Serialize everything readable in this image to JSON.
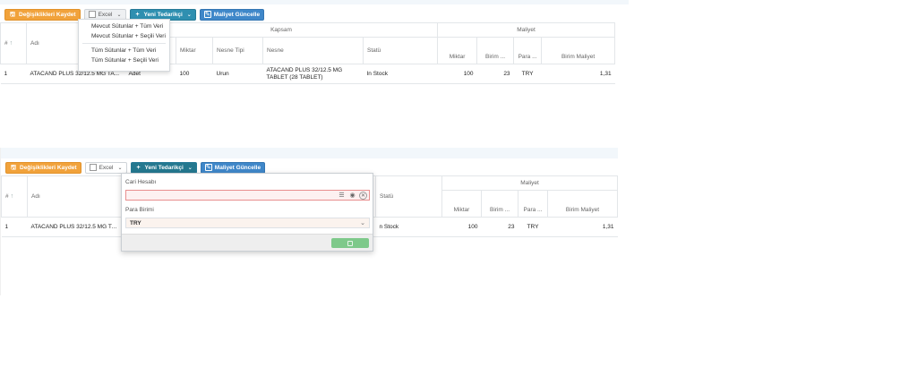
{
  "toolbar": {
    "save": "Değişiklikleri Kaydet",
    "excel": "Excel",
    "new_supplier": "Yeni Tedarikçi",
    "update_cost": "Maliyet Güncelle"
  },
  "excel_menu": [
    "Mevcut Sütunlar + Tüm Veri",
    "Mevcut Sütunlar + Seçili Veri",
    "Tüm Sütunlar + Tüm Veri",
    "Tüm Sütunlar + Seçili Veri"
  ],
  "grid": {
    "group_kapsam": "Kapsam",
    "group_maliyet": "Maliyet",
    "col_no": "#",
    "col_name": "Adı",
    "col_amount": "Miktar",
    "col_object_type": "Nesne Tipi",
    "col_object": "Nesne",
    "col_status": "Statü",
    "col_cost_amount": "Miktar",
    "col_unit": "Birim ...",
    "col_currency": "Para ...",
    "col_unit_cost": "Birim Maliyet",
    "row": {
      "no": "1",
      "name": "ATACAND PLUS 32/12.5 MG TA...",
      "unit_type": "Adet",
      "amount": "100",
      "object_type": "Urun",
      "object": "ATACAND PLUS 32/12.5 MG TABLET (28 TABLET)",
      "status": "In Stock",
      "cost_amount": "100",
      "unit": "23",
      "currency": "TRY",
      "unit_cost": "1,31"
    }
  },
  "popup": {
    "account_label": "Cari Hesabı",
    "account_value": "",
    "currency_label": "Para Birimi",
    "currency_value": "TRY"
  },
  "panel_b": {
    "status_fragment": "Statü",
    "status_value_fragment": "n Stock"
  },
  "icons": {
    "save": "save-icon",
    "excel": "excel-file-icon",
    "new_supplier": "plus-icon",
    "update_cost": "edit-icon",
    "list": "list-icon",
    "eye": "eye-icon",
    "clear": "clear-icon",
    "chevron": "chevron-down-icon"
  },
  "colors": {
    "save_button": "#f1a23b",
    "new_supplier_button": "#2f8fb0",
    "update_cost_button": "#3f87c9",
    "popup_save_button": "#7ec98a",
    "input_error_border": "#e88f8f"
  }
}
